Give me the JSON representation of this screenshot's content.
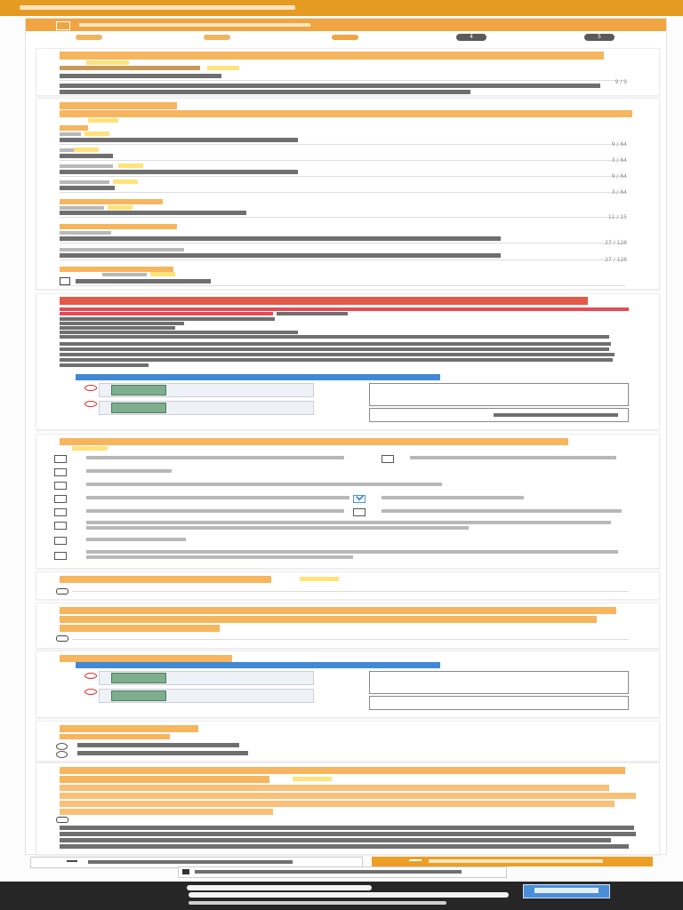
{
  "app": {
    "title": ""
  },
  "header": {
    "section_title": ""
  },
  "steps": [
    {
      "number": "",
      "state": "done"
    },
    {
      "number": "",
      "state": "done"
    },
    {
      "number": "",
      "state": "current"
    },
    {
      "number": "4",
      "state": "todo"
    },
    {
      "number": "5",
      "state": "todo"
    }
  ],
  "inquiry": {
    "title": "",
    "required_label": "",
    "half_width_label": "",
    "value": "",
    "counter": "9 / 9",
    "help": ""
  },
  "applicant": {
    "title": "",
    "subtitle": "",
    "name_label": "",
    "surname_label": "",
    "surname_value": "",
    "surname_counter": "9 / 64",
    "given_label": "",
    "given_value": "",
    "given_counter": "3 / 64",
    "surname_kana_label": "",
    "surname_kana_value": "",
    "surname_kana_counter": "9 / 64",
    "given_kana_label": "",
    "given_kana_value": "",
    "given_kana_counter": "3 / 64",
    "phone_label": "",
    "phone_sub_label": "",
    "phone_value": "",
    "phone_counter": "11 / 15",
    "email_label": "",
    "email_value": "",
    "email_counter": "27 / 128",
    "email_confirm_label": "",
    "email_confirm_value": "",
    "email_confirm_counter": "27 / 128",
    "birth_label": "",
    "birth_sub_label": "",
    "birth_value": ""
  },
  "attach_notice": {
    "title": "",
    "warning": "",
    "items": [],
    "note": "",
    "photo_guide_title": ""
  },
  "doc_select": {
    "title": "",
    "required_label": "",
    "options": [
      {
        "label": "",
        "checked": false
      },
      {
        "label": "",
        "checked": false
      },
      {
        "label": "",
        "checked": false
      },
      {
        "label": "",
        "checked": false
      },
      {
        "label": "",
        "checked": false
      },
      {
        "label": "",
        "checked": true
      },
      {
        "label": "",
        "checked": false
      },
      {
        "label": "",
        "checked": false
      },
      {
        "label": "",
        "checked": false
      },
      {
        "label": "",
        "checked": false
      },
      {
        "label": "",
        "checked": false
      }
    ]
  },
  "doc1": {
    "title": "",
    "required_label": ""
  },
  "doc2": {
    "title": ""
  },
  "bank_upload": {
    "title": "",
    "photo_guide_title": ""
  },
  "bank_info": {
    "title": "",
    "subtitle": "",
    "options": [
      {
        "label": "",
        "selected": false
      },
      {
        "label": "",
        "selected": false
      }
    ]
  },
  "bank_docs": {
    "title": "",
    "required_label": "",
    "warning": "",
    "note": ""
  },
  "buttons": {
    "back_label": "",
    "next_label": "",
    "save_label": ""
  },
  "footer": {
    "powered": "",
    "copyright": "",
    "terms": ""
  },
  "colors": {
    "brand": "#e59a22",
    "accent": "#f0a540",
    "warning": "#d9353d",
    "check": "#4a90e2",
    "footer_bg": "#262626"
  }
}
